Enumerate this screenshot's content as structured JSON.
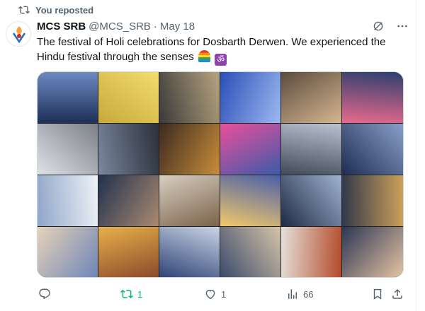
{
  "repost": {
    "label": "You reposted"
  },
  "post": {
    "author_name": "MCS SRB",
    "author_handle": "@MCS_SRB",
    "separator": "·",
    "date": "May 18",
    "text": "The festival of Holi celebrations for Dosbarth Derwen. We experienced the Hindu festival through the senses",
    "emojis": [
      "rainbow",
      "om"
    ]
  },
  "media": {
    "grid": "4x4",
    "tiles": [
      "blue-topped-pupils",
      "yellow-paint-tray",
      "ceremony-tray",
      "colored-powder-hands",
      "classroom-table",
      "teacher-laptop",
      "boy-eating",
      "girl-with-lights",
      "pupils-tray-group",
      "boy-eating-2",
      "children-at-table",
      "girl-colored-lights",
      "boy-holding-item",
      "boy-chair",
      "plate-of-food",
      "plate-sprinkles",
      "red-haired-boy",
      "boy-headphones",
      "red-haired-boy-2",
      "girl-dark-hair-smile",
      "girl-glasses-smile"
    ]
  },
  "metrics": {
    "reposts": "1",
    "likes": "1",
    "views": "66"
  },
  "colors": {
    "repost_green": "#00ba7c",
    "muted": "#536471",
    "text": "#0f1419"
  }
}
